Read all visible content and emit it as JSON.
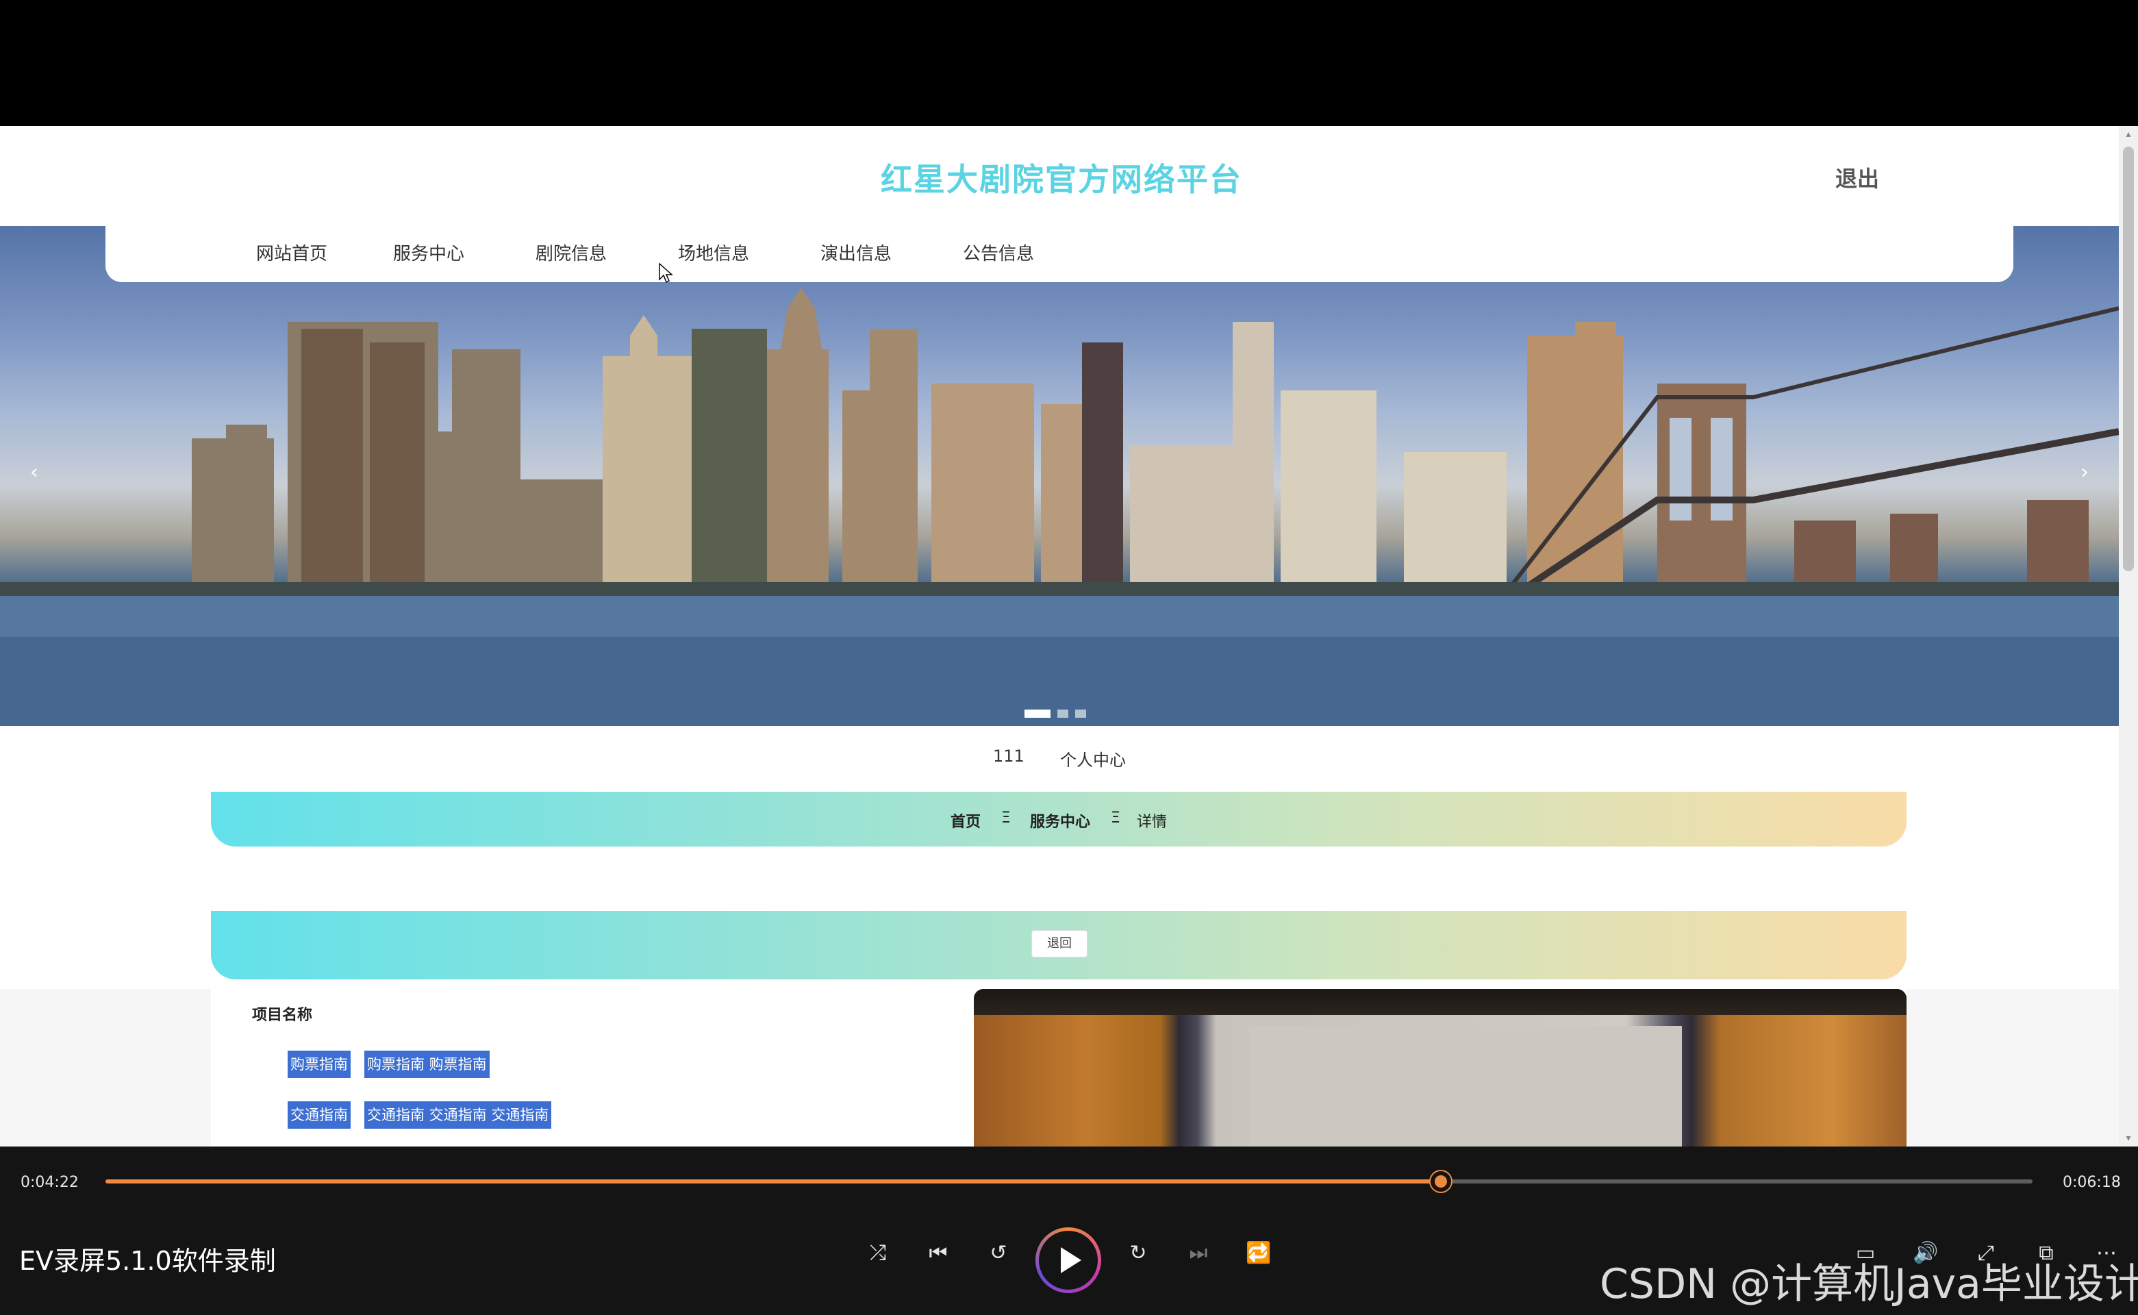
{
  "site": {
    "title": "红星大剧院官方网络平台",
    "logout": "退出"
  },
  "nav": {
    "items": [
      "网站首页",
      "服务中心",
      "剧院信息",
      "场地信息",
      "演出信息",
      "公告信息"
    ]
  },
  "banner": {
    "prev_icon": "‹",
    "next_icon": "›",
    "slide_count": 3,
    "active_slide": 1
  },
  "user": {
    "name": "111",
    "center": "个人中心"
  },
  "breadcrumb": {
    "home": "首页",
    "sep": "Ξ",
    "section": "服务中心",
    "current": "详情"
  },
  "actions": {
    "back": "退回"
  },
  "detail": {
    "label": "项目名称",
    "tags_row1": [
      "购票指南",
      "购票指南 购票指南"
    ],
    "tags_row2": [
      "交通指南",
      "交通指南 交通指南 交通指南"
    ]
  },
  "player": {
    "current_time": "0:04:22",
    "total_time": "0:06:18",
    "progress_fraction": 0.693,
    "app_name": "EV录屏5.1.0软件录制",
    "accent": "#f28a3e"
  },
  "watermark": "CSDN @计算机Java毕业设计"
}
